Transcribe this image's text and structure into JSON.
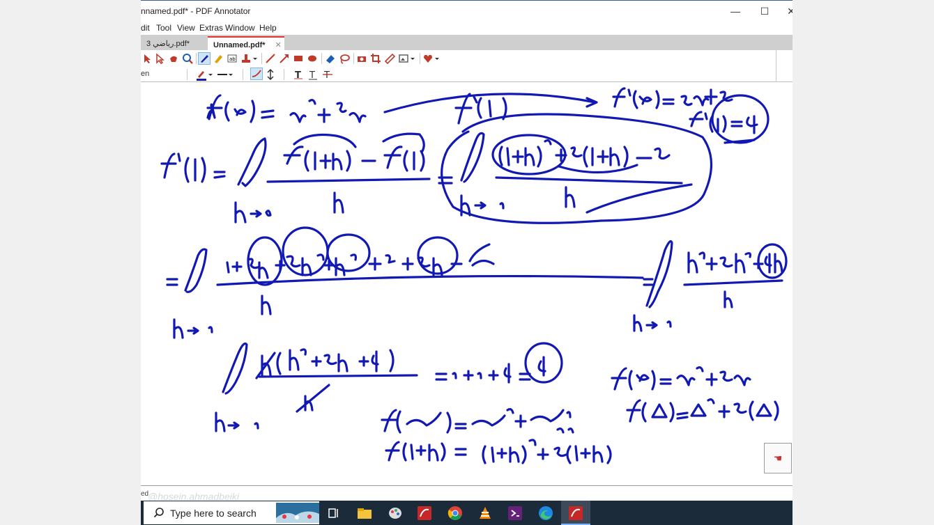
{
  "window": {
    "title": "nnamed.pdf* - PDF Annotator",
    "controls": {
      "minimize": "—",
      "maximize": "☐",
      "close": "✕"
    }
  },
  "menu": [
    "dit",
    "Tool",
    "View",
    "Extras",
    "Window",
    "Help"
  ],
  "tabs": [
    {
      "label": "3 رياضي.pdf*"
    },
    {
      "label": "Unnamed.pdf*",
      "active": true,
      "close": "✕"
    }
  ],
  "toolbar": {
    "tool_label": "en",
    "accent_color": "#1a1aa8"
  },
  "whiteboard": {
    "ink_color": "#1219b3",
    "corner_button": "☚"
  },
  "statusbar": {
    "text": "ed",
    "watermark": "@hosein.ahmadbeiki"
  },
  "taskbar": {
    "search_placeholder": "Type here to search",
    "icons": [
      "task-view-icon",
      "file-explorer-icon",
      "paint-icon",
      "pdf-annotator-icon",
      "chrome-icon",
      "vlc-icon",
      "visual-studio-icon",
      "edge-icon",
      "pdf-annotator-active-icon"
    ]
  }
}
